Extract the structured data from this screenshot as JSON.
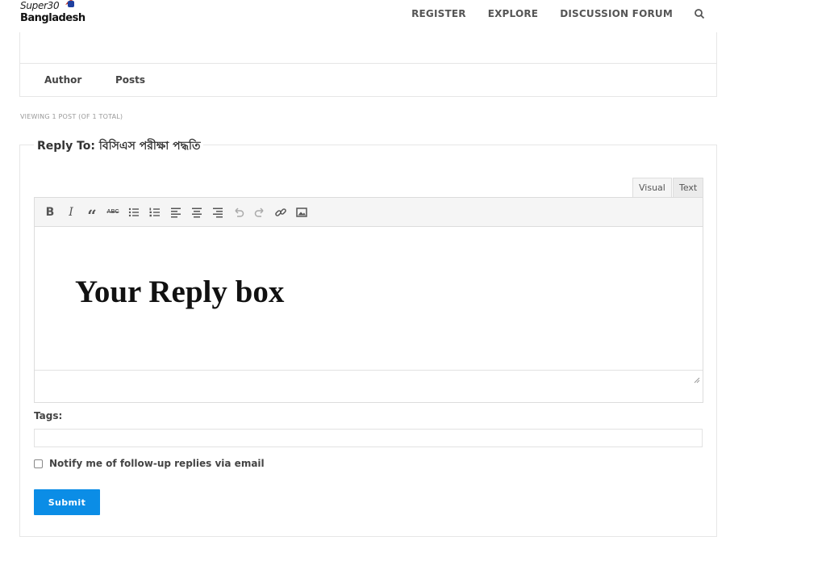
{
  "header": {
    "logo_line1": "Super30",
    "logo_line2": "Bangladesh",
    "nav": [
      "REGISTER",
      "EXPLORE",
      "DISCUSSION FORUM"
    ],
    "search_icon": "search-icon"
  },
  "topic_table": {
    "col_author": "Author",
    "col_posts": "Posts"
  },
  "viewing_text": "VIEWING 1 POST (OF 1 TOTAL)",
  "reply": {
    "legend": "Reply To: বিসিএস পরীক্ষা পদ্ধতি",
    "tabs": {
      "visual": "Visual",
      "text": "Text"
    },
    "toolbar": {
      "bold": "B",
      "italic": "I",
      "quote": "“",
      "strike": "ABC"
    },
    "content": "Your Reply box",
    "tags_label": "Tags:",
    "tags_value": "",
    "notify_label": "Notify me of follow-up replies via email",
    "notify_checked": false,
    "submit_label": "Submit"
  },
  "colors": {
    "accent": "#0b8de6",
    "border": "#e6e6e6",
    "toolbar_bg": "#f5f5f5"
  }
}
